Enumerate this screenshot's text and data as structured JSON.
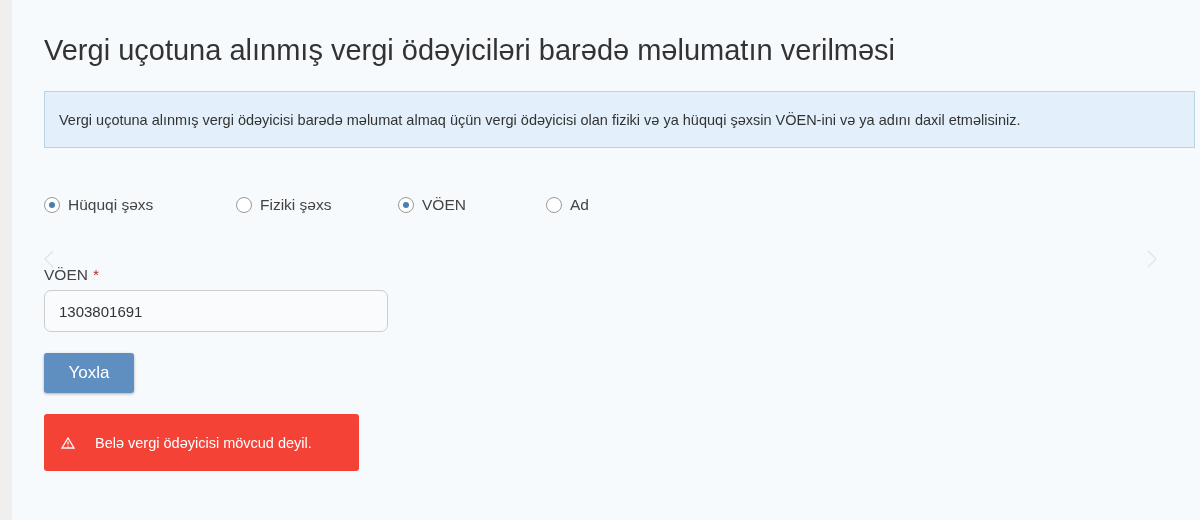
{
  "title": "Vergi uçotuna alınmış vergi ödəyiciləri barədə məlumatın verilməsi",
  "info": "Vergi uçotuna alınmış vergi ödəyicisi barədə məlumat almaq üçün vergi ödəyicisi olan fiziki və ya hüquqi şəxsin VÖEN-ini və ya adını daxil etməlisiniz.",
  "radio_groups": [
    [
      {
        "label": "Hüquqi şəxs",
        "selected": true
      },
      {
        "label": "Fiziki şəxs",
        "selected": false
      }
    ],
    [
      {
        "label": "VÖEN",
        "selected": true
      },
      {
        "label": "Ad",
        "selected": false
      }
    ]
  ],
  "field": {
    "label": "VÖEN",
    "required_mark": "*",
    "value": "1303801691"
  },
  "button": "Yoxla",
  "alert": {
    "message": "Belə vergi ödəyicisi mövcud deyil."
  }
}
